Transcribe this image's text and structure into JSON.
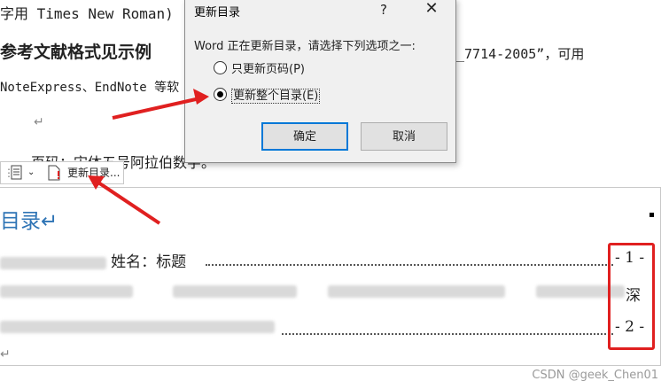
{
  "doc": {
    "line1": "字用 Times New Roman)",
    "heading": "参考文献格式见示例",
    "right_fragment": "_7714-2005”，可用",
    "line3": "NoteExpress、EndNote 等软",
    "para_mark": "↵",
    "page_num_line": "页码：宋体五号阿拉伯数字。"
  },
  "dialog": {
    "title": "更新目录",
    "help": "?",
    "close": "✕",
    "prompt": "Word 正在更新目录，请选择下列选项之一:",
    "options": [
      {
        "label": "只更新页码(P)",
        "checked": false
      },
      {
        "label": "更新整个目录(E)",
        "checked": true
      }
    ],
    "ok": "确定",
    "cancel": "取消"
  },
  "toolbar": {
    "update_label": "更新目录..."
  },
  "toc": {
    "title": "目录↵",
    "entry1_text": "姓名：标题",
    "entry1_page": "- 1 -",
    "entry2_page": "深",
    "entry3_page": "- 2 -",
    "end_mark": "↵"
  },
  "watermark": "CSDN @geek_Chen01",
  "colors": {
    "accent": "#0078d7",
    "toc_title": "#2e74b5",
    "annotation": "#e02020"
  }
}
